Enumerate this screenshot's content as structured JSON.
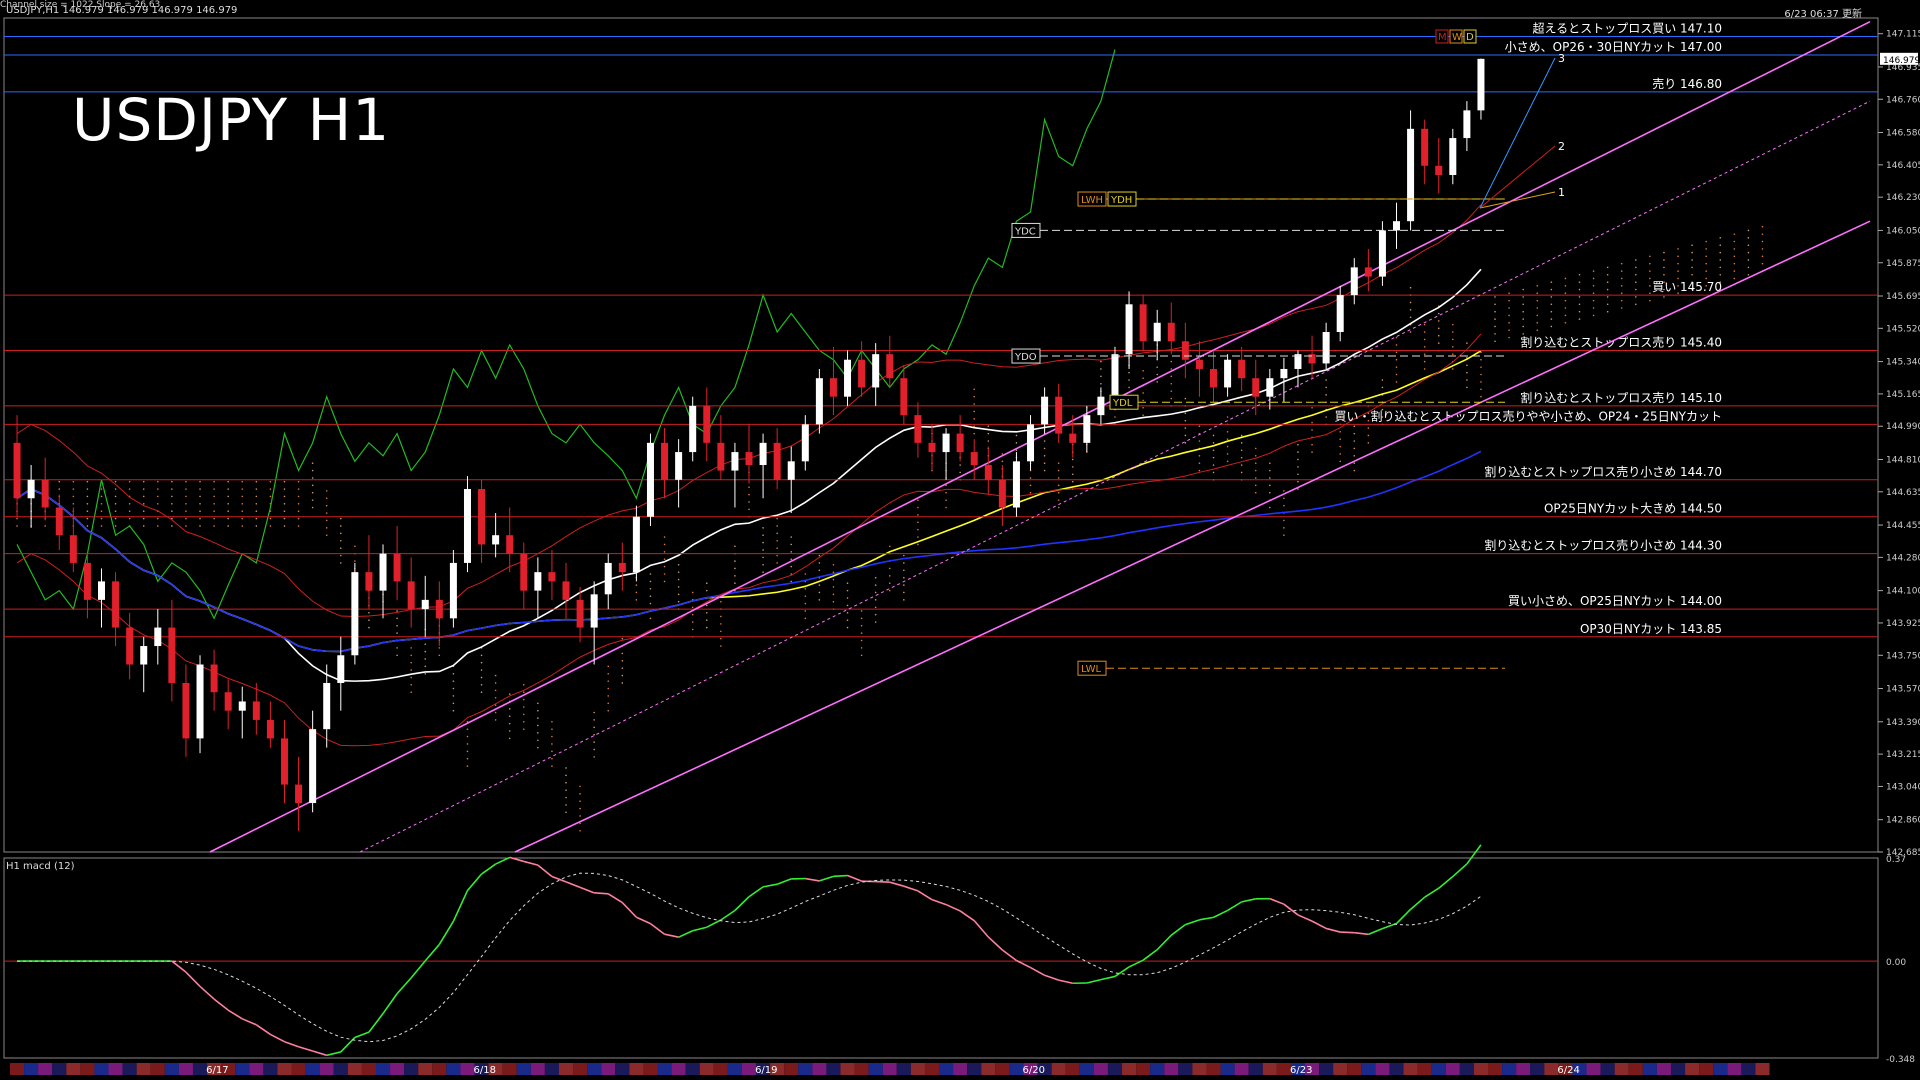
{
  "header": {
    "symbol_info": "USDJPY,H1  146.979 146.979 146.979 146.979",
    "datetime": "6/23 06:37 更新",
    "channel_info": "Channel size = 1022 Slope = 26.63",
    "title": "USDJPY H1"
  },
  "macd_label": "H1  macd (12)",
  "colors": {
    "background": "#000000",
    "bull_candle": "#ffffff",
    "bear_candle": "#e0202a",
    "channel": "#ff70ff",
    "level_line": "#cc1f1f",
    "ma_white": "#ffffff",
    "ma_yellow": "#ffff20",
    "ma_blue": "#2233ff",
    "chikou": "#22bb22",
    "macd_up": "#33ee33",
    "macd_down": "#ff7fa0"
  },
  "chart_data": {
    "type": "candlestick",
    "symbol": "USDJPY",
    "timeframe": "H1",
    "ylim": [
      142.685,
      147.2
    ],
    "y_ticks": [
      "147.115",
      "146.935",
      "146.760",
      "146.580",
      "146.405",
      "146.230",
      "146.050",
      "145.875",
      "145.695",
      "145.520",
      "145.340",
      "145.165",
      "144.990",
      "144.810",
      "144.635",
      "144.455",
      "144.280",
      "144.100",
      "143.925",
      "143.750",
      "143.570",
      "143.390",
      "143.215",
      "143.040",
      "142.860",
      "142.685"
    ],
    "current_price": "146.979",
    "x_dates": [
      {
        "label": "6/17",
        "idx": 14
      },
      {
        "label": "6/18",
        "idx": 33
      },
      {
        "label": "6/19",
        "idx": 53
      },
      {
        "label": "6/20",
        "idx": 72
      },
      {
        "label": "6/23",
        "idx": 91
      },
      {
        "label": "6/24",
        "idx": 110
      }
    ],
    "ohlc": [
      [
        144.9,
        145.05,
        144.5,
        144.6
      ],
      [
        144.6,
        144.78,
        144.44,
        144.7
      ],
      [
        144.7,
        144.82,
        144.48,
        144.55
      ],
      [
        144.55,
        144.62,
        144.32,
        144.4
      ],
      [
        144.4,
        144.55,
        144.2,
        144.25
      ],
      [
        144.25,
        144.3,
        143.95,
        144.05
      ],
      [
        144.05,
        144.22,
        143.9,
        144.15
      ],
      [
        144.15,
        144.2,
        143.8,
        143.9
      ],
      [
        143.9,
        143.98,
        143.62,
        143.7
      ],
      [
        143.7,
        143.85,
        143.55,
        143.8
      ],
      [
        143.8,
        144.0,
        143.7,
        143.9
      ],
      [
        143.9,
        144.05,
        143.5,
        143.6
      ],
      [
        143.6,
        143.7,
        143.2,
        143.3
      ],
      [
        143.3,
        143.75,
        143.22,
        143.7
      ],
      [
        143.7,
        143.78,
        143.45,
        143.55
      ],
      [
        143.55,
        143.62,
        143.35,
        143.45
      ],
      [
        143.45,
        143.58,
        143.3,
        143.5
      ],
      [
        143.5,
        143.6,
        143.32,
        143.4
      ],
      [
        143.4,
        143.5,
        143.25,
        143.3
      ],
      [
        143.3,
        143.4,
        142.95,
        143.05
      ],
      [
        143.05,
        143.2,
        142.8,
        142.95
      ],
      [
        142.95,
        143.45,
        142.9,
        143.35
      ],
      [
        143.35,
        143.7,
        143.25,
        143.6
      ],
      [
        143.6,
        143.85,
        143.45,
        143.75
      ],
      [
        143.75,
        144.25,
        143.7,
        144.2
      ],
      [
        144.2,
        144.4,
        144.0,
        144.1
      ],
      [
        144.1,
        144.35,
        143.95,
        144.3
      ],
      [
        144.3,
        144.45,
        144.05,
        144.15
      ],
      [
        144.15,
        144.28,
        143.9,
        144.0
      ],
      [
        144.0,
        144.18,
        143.85,
        144.05
      ],
      [
        144.05,
        144.15,
        143.8,
        143.95
      ],
      [
        143.95,
        144.32,
        143.9,
        144.25
      ],
      [
        144.25,
        144.72,
        144.2,
        144.65
      ],
      [
        144.65,
        144.7,
        144.25,
        144.35
      ],
      [
        144.35,
        144.52,
        144.28,
        144.4
      ],
      [
        144.4,
        144.55,
        144.2,
        144.3
      ],
      [
        144.3,
        144.36,
        144.0,
        144.1
      ],
      [
        144.1,
        144.28,
        143.95,
        144.2
      ],
      [
        144.2,
        144.32,
        144.05,
        144.15
      ],
      [
        144.15,
        144.25,
        143.95,
        144.05
      ],
      [
        144.05,
        144.12,
        143.82,
        143.9
      ],
      [
        143.9,
        144.15,
        143.7,
        144.08
      ],
      [
        144.08,
        144.3,
        144.0,
        144.25
      ],
      [
        144.25,
        144.36,
        144.1,
        144.2
      ],
      [
        144.2,
        144.56,
        144.15,
        144.5
      ],
      [
        144.5,
        144.95,
        144.45,
        144.9
      ],
      [
        144.9,
        144.98,
        144.6,
        144.7
      ],
      [
        144.7,
        144.92,
        144.55,
        144.85
      ],
      [
        144.85,
        145.15,
        144.8,
        145.1
      ],
      [
        145.1,
        145.2,
        144.8,
        144.9
      ],
      [
        144.9,
        145.05,
        144.7,
        144.75
      ],
      [
        144.75,
        144.9,
        144.55,
        144.85
      ],
      [
        144.85,
        145.0,
        144.68,
        144.78
      ],
      [
        144.78,
        144.95,
        144.6,
        144.9
      ],
      [
        144.9,
        144.98,
        144.65,
        144.7
      ],
      [
        144.7,
        144.88,
        144.52,
        144.8
      ],
      [
        144.8,
        145.05,
        144.75,
        145.0
      ],
      [
        145.0,
        145.3,
        144.95,
        145.25
      ],
      [
        145.25,
        145.42,
        145.05,
        145.15
      ],
      [
        145.15,
        145.4,
        145.1,
        145.35
      ],
      [
        145.35,
        145.45,
        145.15,
        145.2
      ],
      [
        145.2,
        145.44,
        145.1,
        145.38
      ],
      [
        145.38,
        145.48,
        145.2,
        145.25
      ],
      [
        145.25,
        145.32,
        145.0,
        145.05
      ],
      [
        145.05,
        145.12,
        144.82,
        144.9
      ],
      [
        144.9,
        145.0,
        144.75,
        144.85
      ],
      [
        144.85,
        144.98,
        144.7,
        144.95
      ],
      [
        144.95,
        145.05,
        144.8,
        144.85
      ],
      [
        144.85,
        144.92,
        144.7,
        144.78
      ],
      [
        144.78,
        144.88,
        144.62,
        144.7
      ],
      [
        144.7,
        144.78,
        144.45,
        144.55
      ],
      [
        144.55,
        144.85,
        144.5,
        144.8
      ],
      [
        144.8,
        145.05,
        144.75,
        145.0
      ],
      [
        145.0,
        145.2,
        144.95,
        145.15
      ],
      [
        145.15,
        145.22,
        144.9,
        144.95
      ],
      [
        144.95,
        145.05,
        144.82,
        144.9
      ],
      [
        144.9,
        145.1,
        144.85,
        145.05
      ],
      [
        145.05,
        145.2,
        145.0,
        145.15
      ],
      [
        145.15,
        145.42,
        145.1,
        145.38
      ],
      [
        145.38,
        145.72,
        145.3,
        145.65
      ],
      [
        145.65,
        145.7,
        145.4,
        145.45
      ],
      [
        145.45,
        145.62,
        145.35,
        145.55
      ],
      [
        145.55,
        145.66,
        145.38,
        145.45
      ],
      [
        145.45,
        145.55,
        145.25,
        145.35
      ],
      [
        145.35,
        145.45,
        145.15,
        145.3
      ],
      [
        145.3,
        145.4,
        145.12,
        145.2
      ],
      [
        145.2,
        145.38,
        145.15,
        145.35
      ],
      [
        145.35,
        145.42,
        145.18,
        145.25
      ],
      [
        145.25,
        145.35,
        145.05,
        145.15
      ],
      [
        145.15,
        145.3,
        145.08,
        145.25
      ],
      [
        145.25,
        145.36,
        145.12,
        145.3
      ],
      [
        145.3,
        145.4,
        145.2,
        145.38
      ],
      [
        145.38,
        145.48,
        145.25,
        145.33
      ],
      [
        145.33,
        145.55,
        145.3,
        145.5
      ],
      [
        145.5,
        145.75,
        145.45,
        145.7
      ],
      [
        145.7,
        145.9,
        145.65,
        145.85
      ],
      [
        145.85,
        145.95,
        145.72,
        145.8
      ],
      [
        145.8,
        146.1,
        145.75,
        146.05
      ],
      [
        146.05,
        146.2,
        145.95,
        146.1
      ],
      [
        146.1,
        146.7,
        146.05,
        146.6
      ],
      [
        146.6,
        146.65,
        146.3,
        146.4
      ],
      [
        146.4,
        146.55,
        146.25,
        146.35
      ],
      [
        146.35,
        146.6,
        146.3,
        146.55
      ],
      [
        146.55,
        146.75,
        146.48,
        146.7
      ],
      [
        146.7,
        146.98,
        146.65,
        146.979
      ]
    ],
    "horizontal_levels": [
      {
        "price": 147.1,
        "label": "超えるとストップロス買い 147.10",
        "color": "#2a6cff"
      },
      {
        "price": 147.0,
        "label": "小さめ、OP26・30日NYカット 147.00",
        "color": "#2a6cff"
      },
      {
        "price": 146.8,
        "label": "売り 146.80",
        "color": "#2a6cff"
      },
      {
        "price": 145.7,
        "label": "買い 145.70",
        "color": "#cc1f1f"
      },
      {
        "price": 145.4,
        "label": "割り込むとストップロス売り 145.40",
        "color": "#cc1f1f"
      },
      {
        "price": 145.1,
        "label": "割り込むとストップロス売り 145.10",
        "color": "#cc1f1f"
      },
      {
        "price": 145.0,
        "label": "買い・割り込むとストップロス売りやや小さめ、OP24・25日NYカット",
        "color": "#cc1f1f"
      },
      {
        "price": 144.7,
        "label": "割り込むとストップロス売り小さめ 144.70",
        "color": "#cc1f1f"
      },
      {
        "price": 144.5,
        "label": "OP25日NYカット大きめ 144.50",
        "color": "#cc1f1f"
      },
      {
        "price": 144.3,
        "label": "割り込むとストップロス売り小さめ 144.30",
        "color": "#cc1f1f"
      },
      {
        "price": 144.0,
        "label": "買い小さめ、OP25日NYカット 144.00",
        "color": "#cc1f1f"
      },
      {
        "price": 143.85,
        "label": "OP30日NYカット 143.85",
        "color": "#cc1f1f"
      }
    ],
    "markers": [
      {
        "label": "LWH",
        "price": 146.22,
        "color": "#e08a1e"
      },
      {
        "label": "YDH",
        "price": 146.22,
        "color": "#e0d020"
      },
      {
        "label": "YDC",
        "price": 146.05,
        "color": "#dddddd"
      },
      {
        "label": "YDO",
        "price": 145.37,
        "color": "#dddddd"
      },
      {
        "label": "YDL",
        "price": 145.12,
        "color": "#e0d020"
      },
      {
        "label": "LWL",
        "price": 143.68,
        "color": "#e08a1e"
      }
    ],
    "fib_labels": [
      "1",
      "2",
      "3"
    ],
    "mwd_labels": [
      "M",
      "W",
      "D"
    ],
    "macd": {
      "label": "macd (12)",
      "ylim": [
        -0.348,
        0.37
      ],
      "y_ticks": [
        "0.37",
        "0.00",
        "-0.348"
      ]
    }
  }
}
